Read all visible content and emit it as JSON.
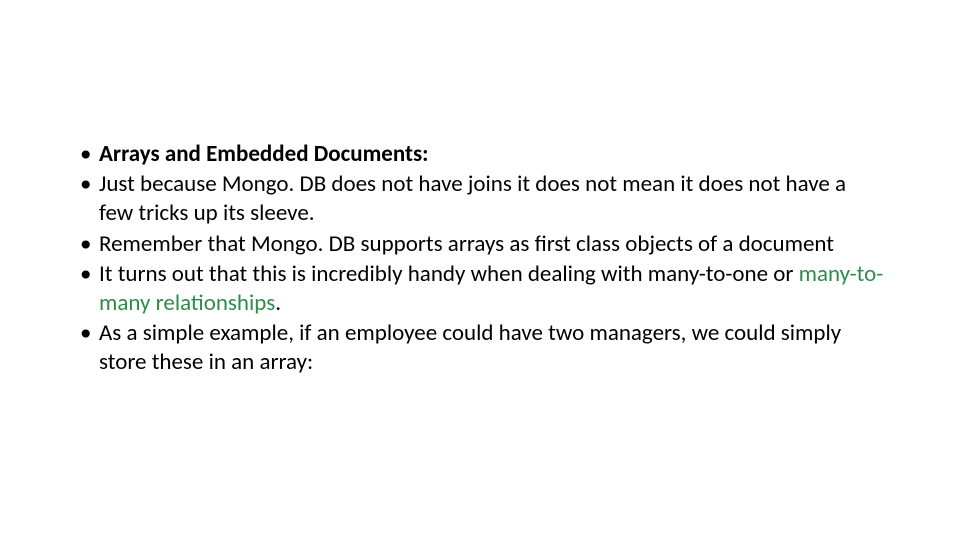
{
  "bullets": {
    "item1_bold": "Arrays and Embedded Documents:",
    "item2": "Just because Mongo. DB does not have joins it does not mean it does not have a few tricks up its sleeve.",
    "item3": "Remember that Mongo. DB supports arrays as first class objects of a document",
    "item4_pre": "It turns out that this is incredibly handy when dealing with many-to-one or ",
    "item4_green": "many-to-many relationships",
    "item4_post": ".",
    "item5": "As a simple example, if an employee could have two managers, we could simply store these in an array:"
  }
}
